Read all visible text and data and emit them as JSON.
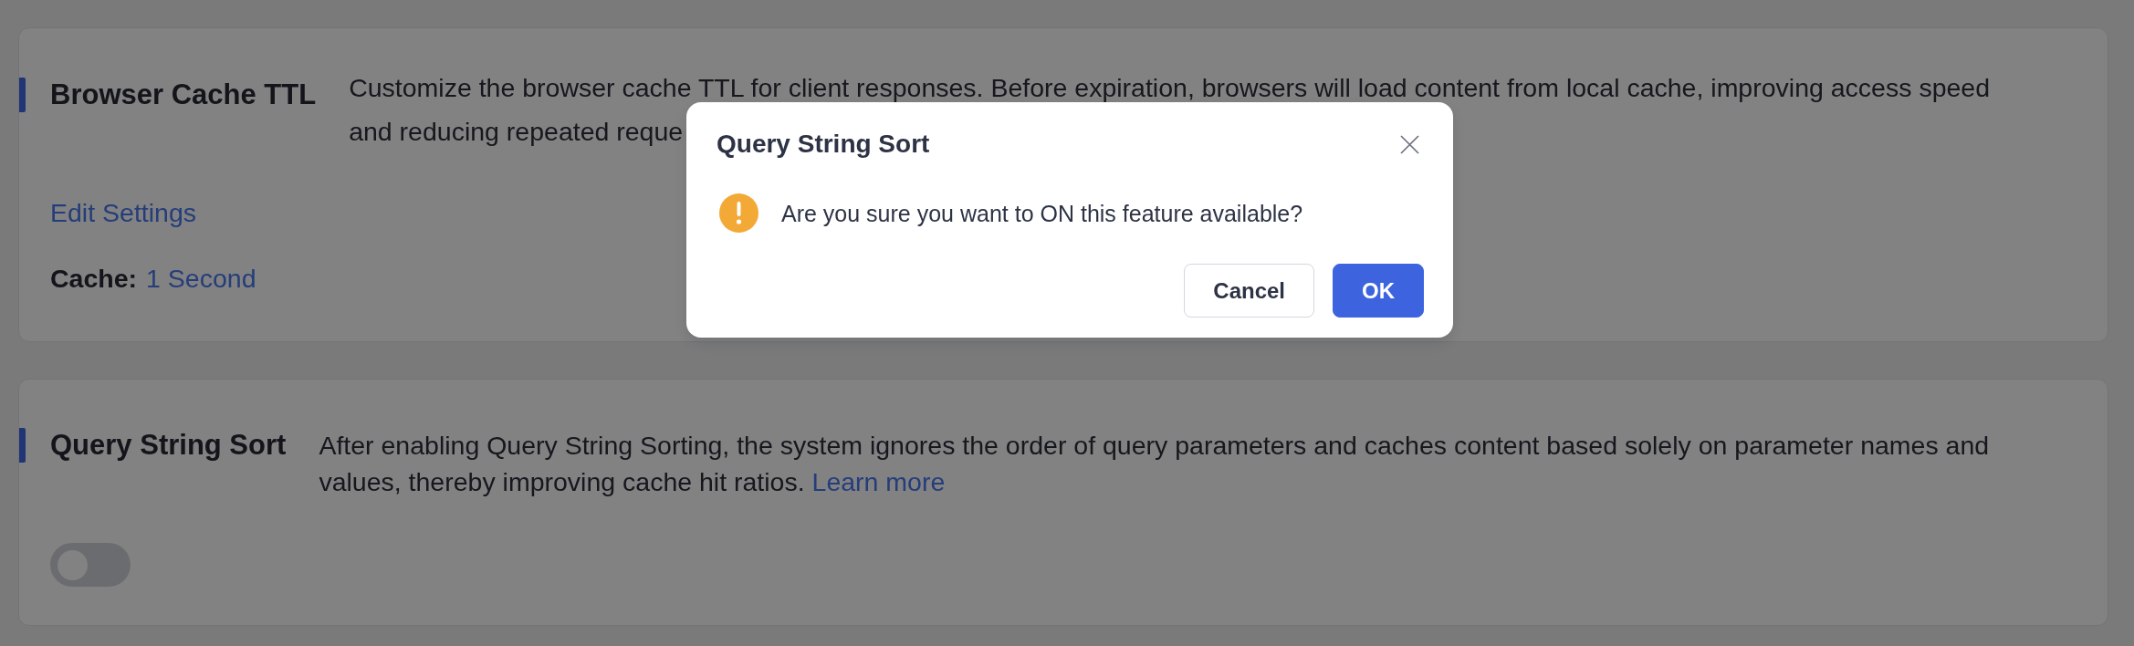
{
  "cards": [
    {
      "kind": "setting",
      "title": "Browser Cache TTL",
      "description_lines": [
        "Customize the browser cache TTL for client responses. Before expiration, browsers will load content from local cache, improving access speed",
        "and reducing repeated reque"
      ],
      "link": "Edit Settings",
      "setting": {
        "label": "Cache:",
        "value": "1 Second"
      }
    },
    {
      "kind": "switch",
      "title": "Query String Sort",
      "description": "After enabling Query String Sorting, the system ignores the order of query parameters and caches content based solely on parameter names and values, thereby improving cache hit ratios.",
      "link": "Learn more",
      "toggle": {
        "on": false
      }
    }
  ],
  "dialog": {
    "title": "Query String Sort",
    "message": "Are you sure you want to ON this feature available?",
    "buttons": [
      {
        "kind": "secondary",
        "label": "Cancel"
      },
      {
        "kind": "primary",
        "label": "OK"
      }
    ]
  }
}
